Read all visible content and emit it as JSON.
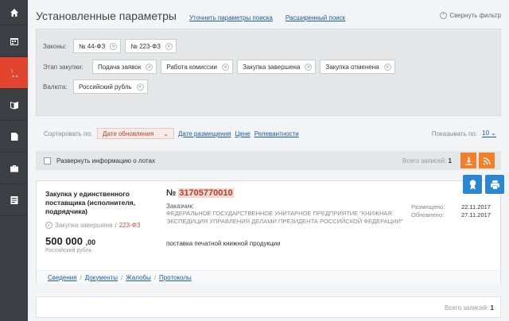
{
  "sidebar": {
    "items": [
      {
        "icon": "home-icon"
      },
      {
        "icon": "calendar-icon"
      },
      {
        "icon": "cart-icon",
        "active": true
      },
      {
        "icon": "book-icon"
      },
      {
        "icon": "document-icon"
      },
      {
        "icon": "briefcase-icon"
      },
      {
        "icon": "list-icon"
      }
    ]
  },
  "header": {
    "title": "Установленные параметры",
    "refine_link": "Уточнить параметры поиска",
    "advanced_link": "Расширенный поиск",
    "collapse_label": "Свернуть фильтр"
  },
  "filters": {
    "laws_label": "Законы:",
    "laws": [
      "№ 44-ФЗ",
      "№ 223-ФЗ"
    ],
    "stage_label": "Этап закупки:",
    "stages": [
      "Подача заявок",
      "Работа комиссии",
      "Закупка завершена",
      "Закупка отменена"
    ],
    "currency_label": "Валюта:",
    "currency": "Российский рубль"
  },
  "sort": {
    "label": "Сортировать по:",
    "selected": "Дате обновления",
    "options": [
      "Дате размещения",
      "Цене",
      "Релевантности"
    ],
    "show_label": "Показывать по:",
    "show_value": "10"
  },
  "expand": {
    "label": "Развернуть информацию о лотах",
    "total_label": "Всего записей:",
    "total_value": "1"
  },
  "card": {
    "type": "Закупка у единственного поставщика (исполнителя, подрядчика)",
    "status": "Закупка завершена",
    "law": "223-ФЗ",
    "price_main": "500 000",
    "price_kop": ",00",
    "currency": "Российский рубль",
    "number_prefix": "№",
    "number": "31705770010",
    "customer_label": "Заказчик:",
    "customer": "ФЕДЕРАЛЬНОЕ ГОСУДАРСТВЕННОЕ УНИТАРНОЕ ПРЕДПРИЯТИЕ \"КНИЖНАЯ ЭКСПЕДИЦИЯ УПРАВЛЕНИЯ ДЕЛАМИ ПРЕЗИДЕНТА РОССИЙСКОЙ ФЕДЕРАЦИИ\"",
    "subject": "поставка печатной книжной продукции",
    "posted_label": "Размещено:",
    "posted": "22.11.2017",
    "updated_label": "Обновлено:",
    "updated": "27.11.2017",
    "tabs": [
      "Сведения",
      "Документы",
      "Жалобы",
      "Протоколы"
    ]
  },
  "footer": {
    "total_label": "Всего записей:",
    "total_value": "1"
  },
  "colors": {
    "accent": "#e2452d",
    "orange": "#f47f2a",
    "blue": "#2c87d3",
    "link": "#1d5aa6"
  }
}
